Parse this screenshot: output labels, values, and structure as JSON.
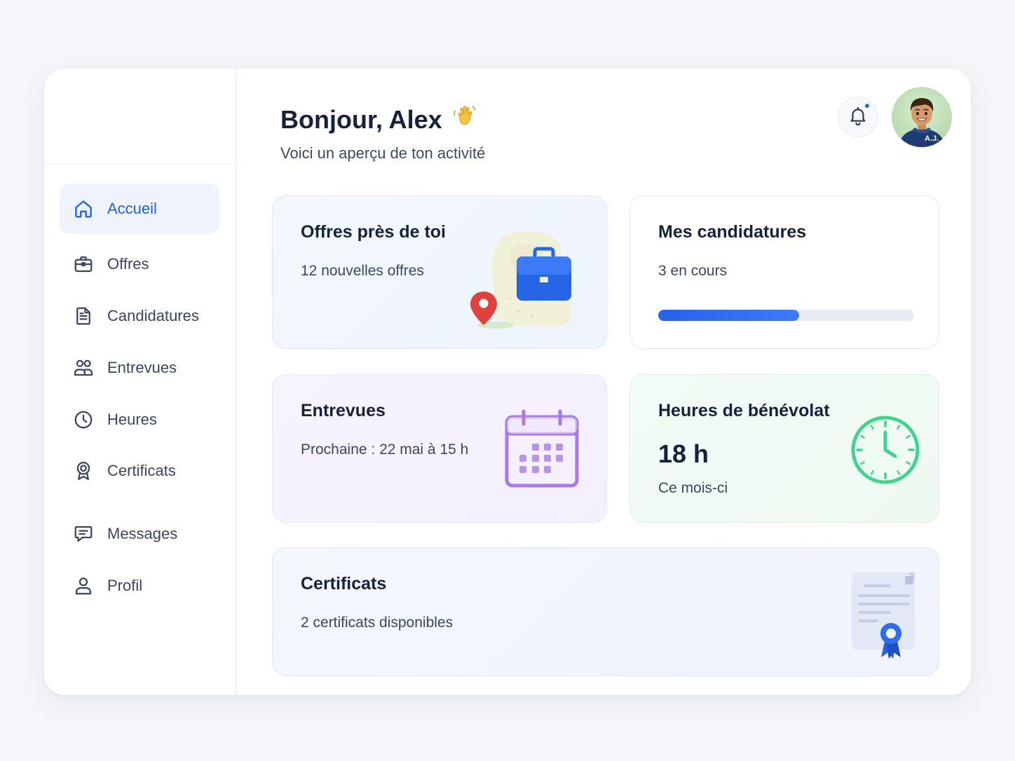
{
  "header": {
    "greeting": "Bonjour, Alex",
    "greeting_emoji": "👋",
    "subtitle": "Voici un aperçu de ton activité",
    "avatar_initials": "A.J."
  },
  "sidebar": {
    "items": [
      {
        "label": "Accueil",
        "icon": "home-icon",
        "active": true
      },
      {
        "label": "Offres",
        "icon": "briefcase-icon"
      },
      {
        "label": "Candidatures",
        "icon": "document-icon"
      },
      {
        "label": "Entrevues",
        "icon": "users-icon"
      },
      {
        "label": "Heures",
        "icon": "clock-icon"
      },
      {
        "label": "Certificats",
        "icon": "award-icon"
      },
      {
        "label": "Messages",
        "icon": "message-icon"
      },
      {
        "label": "Profil",
        "icon": "user-icon"
      }
    ]
  },
  "cards": {
    "offres": {
      "title": "Offres près de toi",
      "desc": "12 nouvelles offres"
    },
    "candidatures": {
      "title": "Mes candidatures",
      "desc": "3 en cours",
      "progress": 0.55
    },
    "entrevues": {
      "title": "Entrevues",
      "desc": "Prochaine : 22 mai à 15 h"
    },
    "heures": {
      "title": "Heures de bénévolat",
      "value": "18 h",
      "desc": "Ce mois-ci"
    },
    "certificats": {
      "title": "Certificats",
      "desc": "2 certificats disponibles"
    }
  },
  "colors": {
    "accent": "#2563eb",
    "active_bg": "#eef3fe",
    "purple": "#a779e9",
    "green": "#3dd68c"
  }
}
